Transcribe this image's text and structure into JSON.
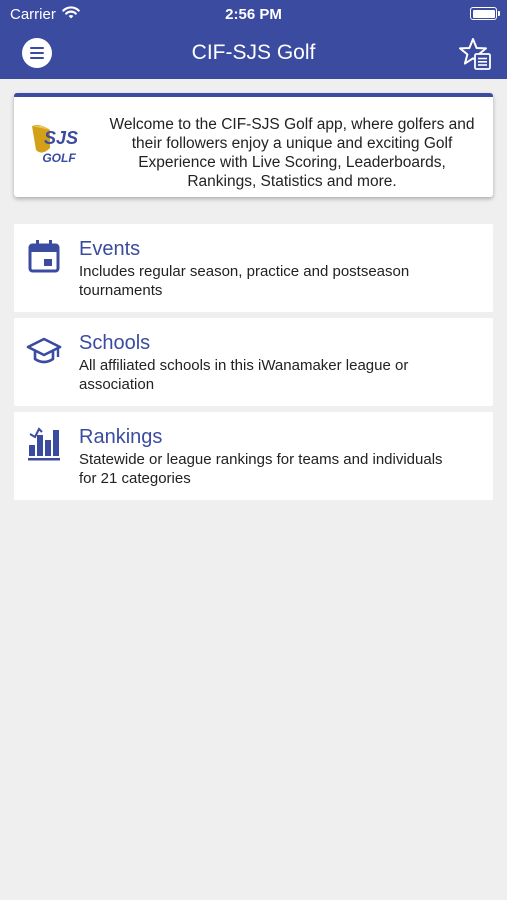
{
  "status_bar": {
    "carrier": "Carrier",
    "time": "2:56 PM"
  },
  "header": {
    "title": "CIF-SJS Golf"
  },
  "welcome": {
    "logo_text_top": "SJS",
    "logo_text_bottom": "GOLF",
    "message": "Welcome to the CIF-SJS Golf app, where golfers and their followers enjoy a unique and exciting Golf Experience with Live Scoring, Leaderboards, Rankings, Statistics and more."
  },
  "nav_items": [
    {
      "title": "Events",
      "description": "Includes regular season, practice and postseason tournaments",
      "icon": "calendar-icon"
    },
    {
      "title": "Schools",
      "description": "All affiliated schools in this iWanamaker league or association",
      "icon": "graduation-cap-icon"
    },
    {
      "title": "Rankings",
      "description": "Statewide or league rankings for teams and individuals for 21 categories",
      "icon": "bar-chart-icon"
    }
  ],
  "colors": {
    "primary": "#3b4ba0",
    "background": "#efefef",
    "card": "#ffffff",
    "logo_gold": "#d4a017"
  }
}
